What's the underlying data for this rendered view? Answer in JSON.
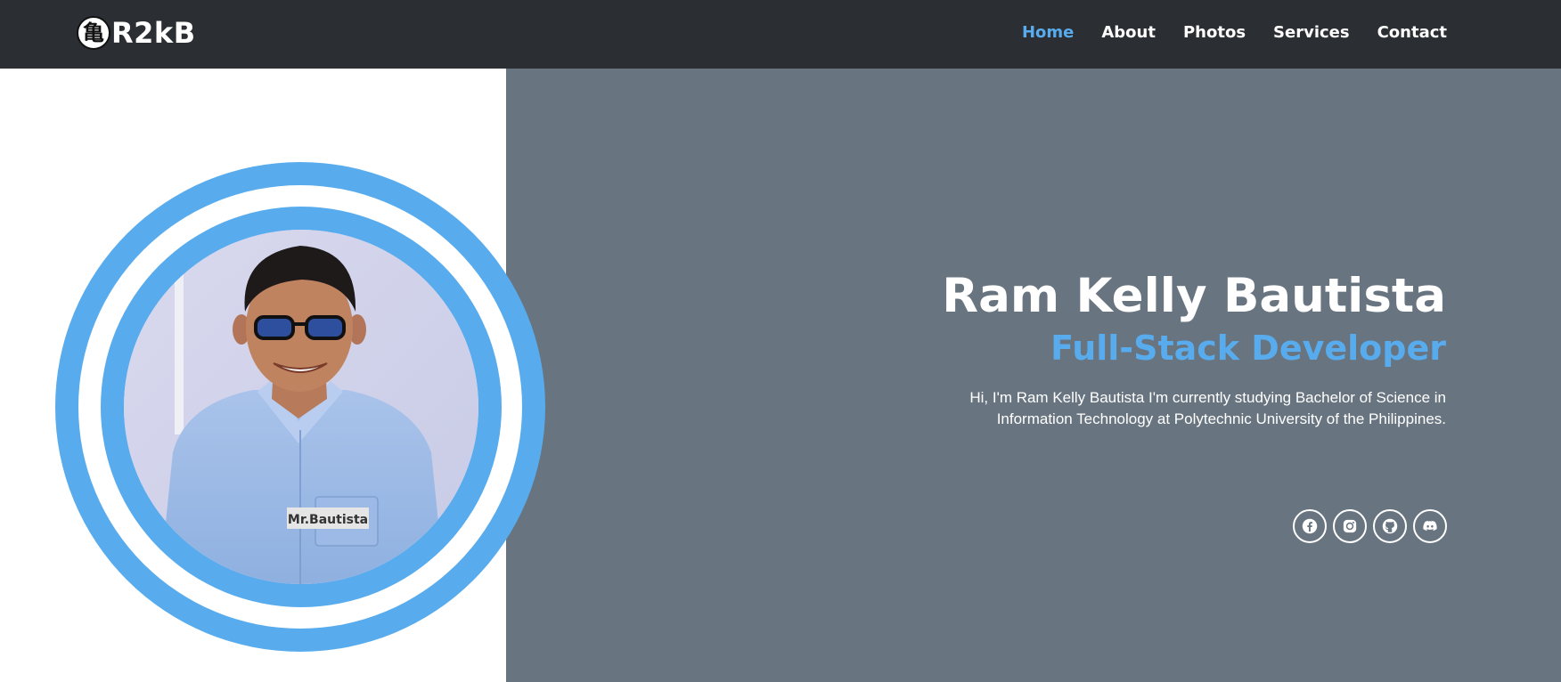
{
  "nav": {
    "logo_glyph": "亀",
    "brand": "R2kB",
    "links": [
      "Home",
      "About",
      "Photos",
      "Services",
      "Contact"
    ],
    "active_index": 0
  },
  "hero": {
    "name": "Ram Kelly Bautista",
    "role": "Full-Stack Developer",
    "bio_line1": "Hi, I'm Ram Kelly Bautista I'm currently studying Bachelor of Science in",
    "bio_line2": "Information Technology at Polytechnic University of the Philippines.",
    "photo_nametag": "Mr.Bautista"
  },
  "socials": [
    {
      "icon": "facebook-icon"
    },
    {
      "icon": "instagram-icon"
    },
    {
      "icon": "github-icon"
    },
    {
      "icon": "discord-icon"
    }
  ],
  "colors": {
    "navbar_bg": "#2b2f33",
    "hero_bg": "#68747f",
    "accent": "#58acee",
    "text_light": "#ffffff"
  }
}
